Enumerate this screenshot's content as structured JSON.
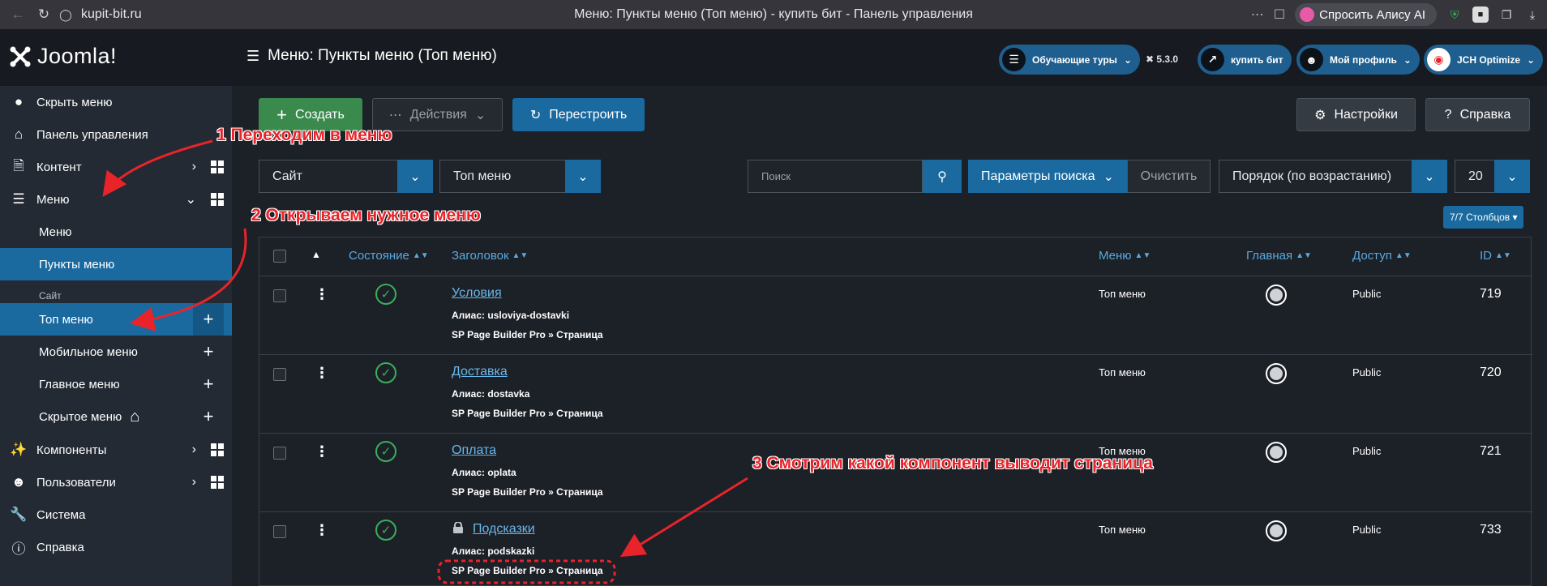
{
  "browser": {
    "url": "kupit-bit.ru",
    "title": "Меню: Пункты меню (Топ меню) - купить бит - Панель управления",
    "alice": "Спросить Алису AI"
  },
  "header": {
    "logo": "Joomla!",
    "page_title": "Меню: Пункты меню (Топ меню)",
    "tours": "Обучающие туры",
    "version": "5.3.0",
    "site_link": "купить бит",
    "profile": "Мой профиль",
    "jch": "JCH Optimize"
  },
  "sidebar": {
    "items": [
      {
        "label": "Скрыть меню",
        "icon": "toggle-icon"
      },
      {
        "label": "Панель управления",
        "icon": "home-icon"
      },
      {
        "label": "Контент",
        "icon": "file-icon"
      },
      {
        "label": "Меню",
        "icon": "list-icon"
      },
      {
        "label": "Компоненты",
        "icon": "puzzle-icon"
      },
      {
        "label": "Пользователи",
        "icon": "users-icon"
      },
      {
        "label": "Система",
        "icon": "wrench-icon"
      },
      {
        "label": "Справка",
        "icon": "info-icon"
      }
    ],
    "submenu": {
      "menus": "Меню",
      "items": "Пункты меню",
      "section": "Сайт",
      "top_menu": "Топ меню",
      "mobile_menu": "Мобильное меню",
      "main_menu": "Главное меню",
      "hidden_menu": "Скрытое меню"
    }
  },
  "toolbar": {
    "create": "Создать",
    "actions": "Действия",
    "rebuild": "Перестроить",
    "options": "Настройки",
    "help": "Справка"
  },
  "filters": {
    "client": "Сайт",
    "menu": "Топ меню",
    "search_placeholder": "Поиск",
    "search_options": "Параметры поиска",
    "clear": "Очистить",
    "ordering": "Порядок (по возрастанию)",
    "limit": "20",
    "columns": "7/7 Столбцов"
  },
  "table": {
    "headers": {
      "status": "Состояние",
      "title": "Заголовок",
      "menu": "Меню",
      "home": "Главная",
      "access": "Доступ",
      "id": "ID"
    },
    "rows": [
      {
        "title": "Условия",
        "alias": "Алиас: usloviya-dostavki",
        "component": "SP Page Builder Pro » Страница",
        "menu": "Топ меню",
        "access": "Public",
        "id": "719"
      },
      {
        "title": "Доставка",
        "alias": "Алиас: dostavka",
        "component": "SP Page Builder Pro » Страница",
        "menu": "Топ меню",
        "access": "Public",
        "id": "720"
      },
      {
        "title": "Оплата",
        "alias": "Алиас: oplata",
        "component": "SP Page Builder Pro » Страница",
        "menu": "Топ меню",
        "access": "Public",
        "id": "721"
      },
      {
        "title": "Подсказки",
        "alias": "Алиас: podskazki",
        "component": "SP Page Builder Pro » Страница",
        "menu": "Топ меню",
        "access": "Public",
        "id": "733"
      }
    ]
  },
  "annotations": {
    "step1": "1 Переходим в меню",
    "step2": "2 Открываем нужное меню",
    "step3": "3 Смотрим какой компонент выводит страница",
    "color": "#e8242a"
  }
}
